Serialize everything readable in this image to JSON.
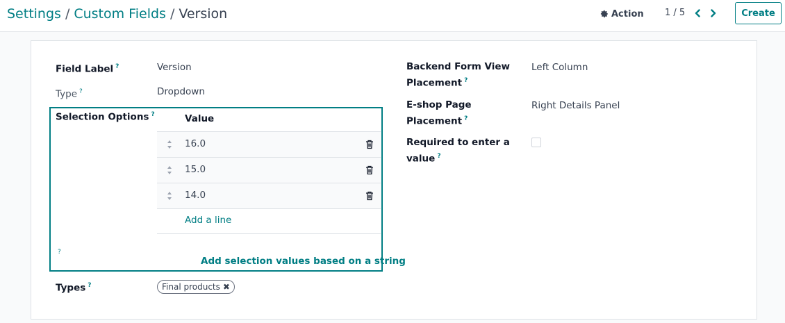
{
  "breadcrumb": {
    "settings": "Settings",
    "separator": "/",
    "custom_fields": "Custom Fields",
    "current": "Version"
  },
  "toolbar": {
    "action_label": "Action",
    "pager": "1 / 5",
    "create_label": "Create"
  },
  "form": {
    "field_label": {
      "label": "Field Label",
      "value": "Version"
    },
    "type": {
      "label": "Type",
      "value": "Dropdown"
    },
    "selection_options": {
      "label": "Selection Options",
      "column_header": "Value",
      "rows": [
        {
          "value": "16.0"
        },
        {
          "value": "15.0"
        },
        {
          "value": "14.0"
        }
      ],
      "add_line": "Add a line",
      "add_based_on_string": "Add selection values based on a string"
    },
    "types": {
      "label": "Types",
      "tags": [
        "Final products"
      ]
    },
    "backend_placement": {
      "label_line1": "Backend Form View",
      "label_line2": "Placement",
      "value": "Left Column"
    },
    "eshop_placement": {
      "label_line1": "E-shop Page",
      "label_line2": "Placement",
      "value": "Right Details Panel"
    },
    "required": {
      "label_line1": "Required to enter a",
      "label_line2": "value",
      "checked": false
    }
  },
  "help_mark": "?",
  "colors": {
    "accent": "#017e84"
  },
  "icons": {
    "action": "gear-icon",
    "prev": "chevron-left-icon",
    "next": "chevron-right-icon",
    "drag": "drag-handle-icon",
    "delete": "trash-icon",
    "tag_remove": "close-icon"
  }
}
